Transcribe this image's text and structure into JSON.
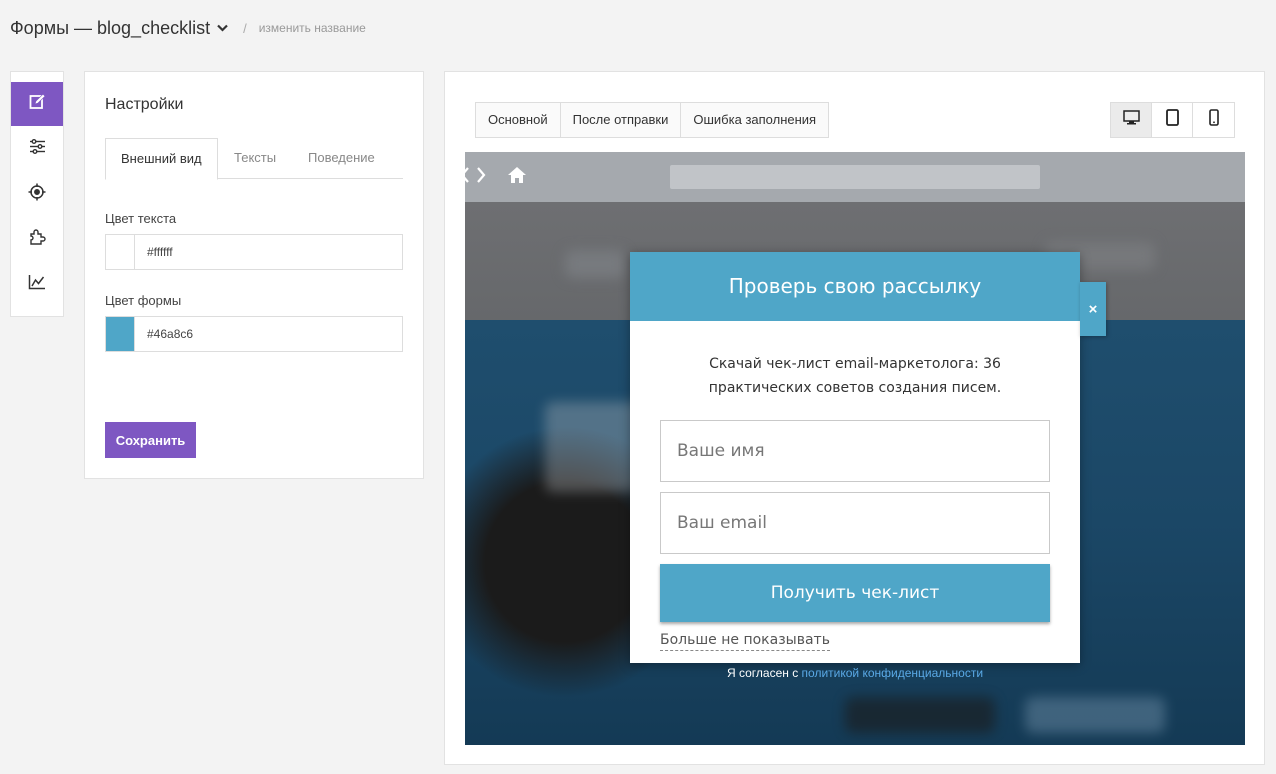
{
  "header": {
    "title": "Формы — blog_checklist",
    "separator": "/",
    "rename_link": "изменить название"
  },
  "iconbar": {
    "items": [
      {
        "icon": "edit-icon",
        "active": true
      },
      {
        "icon": "sliders-icon",
        "active": false
      },
      {
        "icon": "target-icon",
        "active": false
      },
      {
        "icon": "puzzle-icon",
        "active": false
      },
      {
        "icon": "chart-line-icon",
        "active": false
      }
    ],
    "accent": "#7e57c2"
  },
  "settings": {
    "title": "Настройки",
    "tabs": [
      {
        "label": "Внешний вид",
        "active": true
      },
      {
        "label": "Тексты",
        "active": false
      },
      {
        "label": "Поведение",
        "active": false
      }
    ],
    "text_color_label": "Цвет текста",
    "text_color_value": "#ffffff",
    "form_color_label": "Цвет формы",
    "form_color_value": "#46a8c6",
    "save_label": "Сохранить"
  },
  "preview": {
    "state_tabs": [
      "Основной",
      "После отправки",
      "Ошибка заполнения"
    ],
    "devices": [
      {
        "icon": "desktop-icon",
        "active": true
      },
      {
        "icon": "tablet-icon",
        "active": false
      },
      {
        "icon": "phone-icon",
        "active": false
      }
    ],
    "popup": {
      "title": "Проверь свою рассылку",
      "description_line1": "Скачай чек-лист email-маркетолога: 36",
      "description_line2": "практических советов создания писем.",
      "name_placeholder": "Ваше имя",
      "email_placeholder": "Ваш email",
      "button_label": "Получить чек-лист",
      "dismiss_label": "Больше не показывать",
      "close_symbol": "×",
      "color": "#4fa6c8"
    },
    "consent_text": "Я согласен с ",
    "consent_link": "политикой конфиденциальности"
  }
}
